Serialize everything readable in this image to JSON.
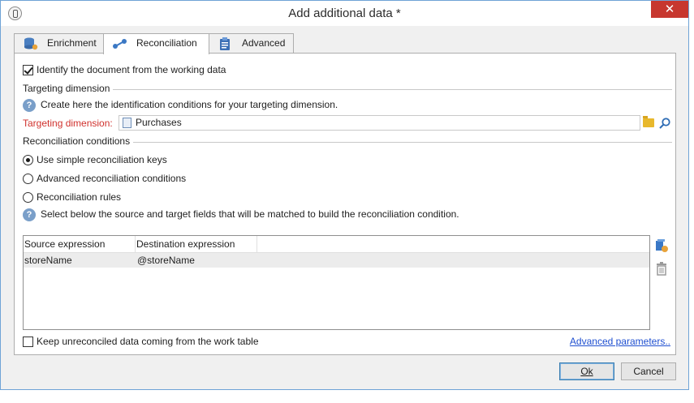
{
  "window": {
    "title": "Add additional data *",
    "close_label": "✕"
  },
  "tabs": [
    {
      "label": "Enrichment",
      "icon": "database-icon",
      "active": false
    },
    {
      "label": "Reconciliation",
      "icon": "link-icon",
      "active": true
    },
    {
      "label": "Advanced",
      "icon": "clipboard-icon",
      "active": false
    }
  ],
  "panel": {
    "identify_checkbox_label": "Identify the document from the working data",
    "identify_checked": true,
    "targeting_section_title": "Targeting dimension",
    "targeting_help_text": "Create here the identification conditions for your targeting dimension.",
    "targeting_dimension_label": "Targeting dimension:",
    "targeting_dimension_value": "Purchases",
    "reconciliation_section_title": "Reconciliation conditions",
    "options": [
      {
        "label": "Use simple reconciliation keys",
        "selected": true
      },
      {
        "label": "Advanced reconciliation conditions",
        "selected": false
      },
      {
        "label": "Reconciliation rules",
        "selected": false
      }
    ],
    "select_help_text": "Select below the source and target fields that will be matched to build the reconciliation condition.",
    "grid": {
      "columns": [
        "Source expression",
        "Destination expression"
      ],
      "rows": [
        {
          "source": "storeName",
          "destination": "@storeName"
        }
      ]
    },
    "keep_unreconciled_label": "Keep unreconciled data coming from the work table",
    "keep_unreconciled_checked": false,
    "advanced_parameters_link": "Advanced parameters.."
  },
  "footer": {
    "ok_label": "Ok",
    "cancel_label": "Cancel"
  },
  "colors": {
    "required_label": "#d0312d",
    "link": "#1f4fd0",
    "close_button": "#c7372f"
  }
}
